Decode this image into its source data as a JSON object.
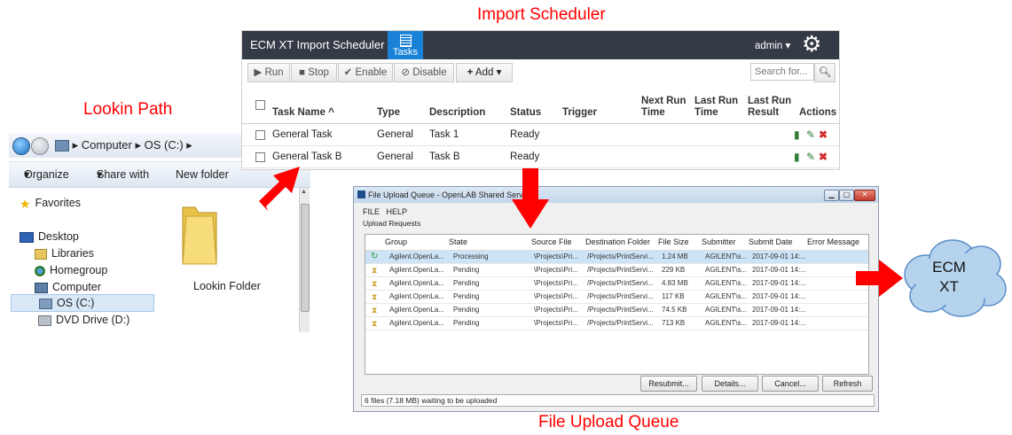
{
  "captions": {
    "import_scheduler": "Import Scheduler",
    "lookin_path": "Lookin Path",
    "file_upload_queue": "File Upload Queue"
  },
  "colors": {
    "arrow": "#ff0000",
    "cloud_fill": "#b6d3ee",
    "cloud_stroke": "#5b8fc9",
    "app_bar": "#343a46",
    "tasks_tab": "#1a82d6"
  },
  "explorer": {
    "breadcrumb": [
      "Computer",
      "OS (C:)"
    ],
    "commands": [
      "Organize",
      "Share with",
      "New folder"
    ],
    "tree": {
      "favorites": "Favorites",
      "desktop": "Desktop",
      "libraries": "Libraries",
      "homegroup": "Homegroup",
      "computer": "Computer",
      "os_drive": "OS (C:)",
      "dvd_drive": "DVD Drive (D:)"
    },
    "folder_label": "Lookin Folder"
  },
  "scheduler": {
    "app_title": "ECM XT Import Scheduler",
    "tab_label": "Tasks",
    "user": "admin",
    "toolbar": {
      "run": "Run",
      "stop": "Stop",
      "enable": "Enable",
      "disable": "Disable",
      "add": "Add"
    },
    "search_placeholder": "Search for...",
    "columns": {
      "task_name": "Task Name",
      "type": "Type",
      "description": "Description",
      "status": "Status",
      "trigger": "Trigger",
      "next_run_1": "Next Run",
      "next_run_2": "Time",
      "last_run_1": "Last Run",
      "last_run_2": "Time",
      "last_result_1": "Last Run",
      "last_result_2": "Result",
      "actions": "Actions"
    },
    "rows": [
      {
        "name": "General Task",
        "type": "General",
        "description": "Task 1",
        "status": "Ready"
      },
      {
        "name": "General Task B",
        "type": "General",
        "description": "Task B",
        "status": "Ready"
      }
    ]
  },
  "queue": {
    "window_title": "File Upload Queue - OpenLAB Shared Services",
    "menu": {
      "file": "FILE",
      "help": "HELP"
    },
    "section_label": "Upload Requests",
    "columns": {
      "group": "Group",
      "state": "State",
      "source": "Source File",
      "destination": "Destination Folder",
      "size": "File Size",
      "submitter": "Submitter",
      "date": "Submit Date",
      "error": "Error Message"
    },
    "rows": [
      {
        "group": "Agilent.OpenLa...",
        "state": "Processing",
        "source": "\\Projects\\Pri...",
        "destination": "/Projects/PrintServi...",
        "size": "1.24 MB",
        "submitter": "AGILENT\\s...",
        "date": "2017-09-01 14:..."
      },
      {
        "group": "Agilent.OpenLa...",
        "state": "Pending",
        "source": "\\Projects\\Pri...",
        "destination": "/Projects/PrintServi...",
        "size": "229 KB",
        "submitter": "AGILENT\\s...",
        "date": "2017-09-01 14:..."
      },
      {
        "group": "Agilent.OpenLa...",
        "state": "Pending",
        "source": "\\Projects\\Pri...",
        "destination": "/Projects/PrintServi...",
        "size": "4.83 MB",
        "submitter": "AGILENT\\s...",
        "date": "2017-09-01 14:..."
      },
      {
        "group": "Agilent.OpenLa...",
        "state": "Pending",
        "source": "\\Projects\\Pri...",
        "destination": "/Projects/PrintServi...",
        "size": "117 KB",
        "submitter": "AGILENT\\s...",
        "date": "2017-09-01 14:..."
      },
      {
        "group": "Agilent.OpenLa...",
        "state": "Pending",
        "source": "\\Projects\\Pri...",
        "destination": "/Projects/PrintServi...",
        "size": "74.5 KB",
        "submitter": "AGILENT\\s...",
        "date": "2017-09-01 14:..."
      },
      {
        "group": "Agilent.OpenLa...",
        "state": "Pending",
        "source": "\\Projects\\Pri...",
        "destination": "/Projects/PrintServi...",
        "size": "713 KB",
        "submitter": "AGILENT\\s...",
        "date": "2017-09-01 14:..."
      }
    ],
    "buttons": {
      "resubmit": "Resubmit...",
      "details": "Details...",
      "cancel": "Cancel...",
      "refresh": "Refresh"
    },
    "status": "6 files (7.18 MB) waiting to be uploaded"
  },
  "cloud": {
    "line1": "ECM",
    "line2": "XT"
  }
}
